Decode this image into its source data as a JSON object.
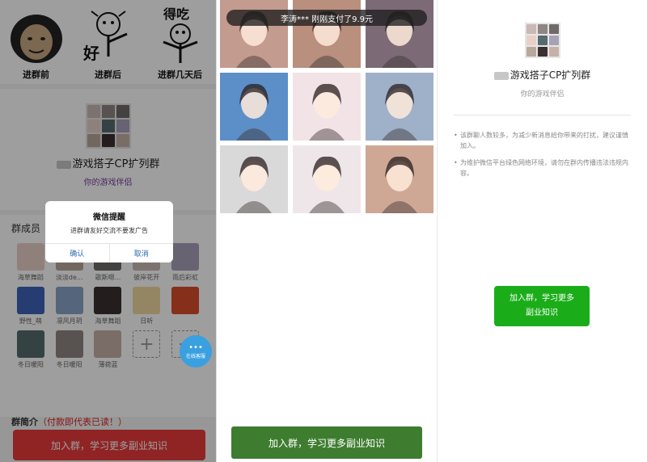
{
  "left": {
    "memes": [
      {
        "caption": "进群前",
        "word": ""
      },
      {
        "caption": "进群后",
        "word": "好"
      },
      {
        "caption": "进群几天后",
        "word": "得吃"
      }
    ],
    "group_name": "游戏搭子CP扩列群",
    "group_subtitle": "你的游戏伴侣",
    "members_title": "群成员",
    "members": [
      {
        "name": "海草舞蹈",
        "color": "#e9cfc7"
      },
      {
        "name": "淡淡de...",
        "color": "#b9a79a"
      },
      {
        "name": "歌斯嗯...",
        "color": "#6f6a69"
      },
      {
        "name": "彼岸花开",
        "color": "#c9b8b3"
      },
      {
        "name": "雨后彩虹",
        "color": "#a7a1b8"
      },
      {
        "name": "野性_萌",
        "color": "#3c63b8"
      },
      {
        "name": "凛风月玥",
        "color": "#8aa4c7"
      },
      {
        "name": "海草舞蹈",
        "color": "#3a3030"
      },
      {
        "name": "日听",
        "color": "#f0d8a0"
      },
      {
        "name": "",
        "color": "#d94c2a"
      },
      {
        "name": "冬日暖阳",
        "color": "#556b6f"
      },
      {
        "name": "冬日暖阳",
        "color": "#8f8582"
      },
      {
        "name": "薄荷蓝",
        "color": "#c6b1a6"
      }
    ],
    "add_symbol": "+",
    "remove_symbol": "−",
    "intro_label": "群简介",
    "intro_note": "（付款即代表已读！）",
    "join_button": "加入群，学习更多副业知识",
    "dialog": {
      "title": "微信提醒",
      "message": "进群请友好交流不要发广告",
      "confirm": "确认",
      "cancel": "取消"
    },
    "service_label": "在线客服",
    "service_icon": "chat-bubble-icon",
    "accent": "#e83a3a"
  },
  "middle": {
    "toast": "李涛*** 刚刚支付了9.9元",
    "photo_colors": [
      "#c49b8f",
      "#b98f7e",
      "#7d6a77",
      "#5c8fc7",
      "#f2e3e7",
      "#9fb0c9",
      "#d9d9d9",
      "#efe6e9",
      "#cfa895"
    ],
    "join_button": "加入群，学习更多副业知识",
    "accent": "#3e7d2f"
  },
  "right": {
    "group_name": "游戏搭子CP扩列群",
    "group_subtitle": "你的游戏伴侣",
    "notes": [
      "该群聊人数较多，为减少新消息给你带来的打扰，建议谨慎加入。",
      "为维护微信平台绿色网络环境，请勿在群内传播违法违规内容。"
    ],
    "join_button_line1": "加入群，学习更多",
    "join_button_line2": "副业知识",
    "accent": "#1aad19"
  }
}
